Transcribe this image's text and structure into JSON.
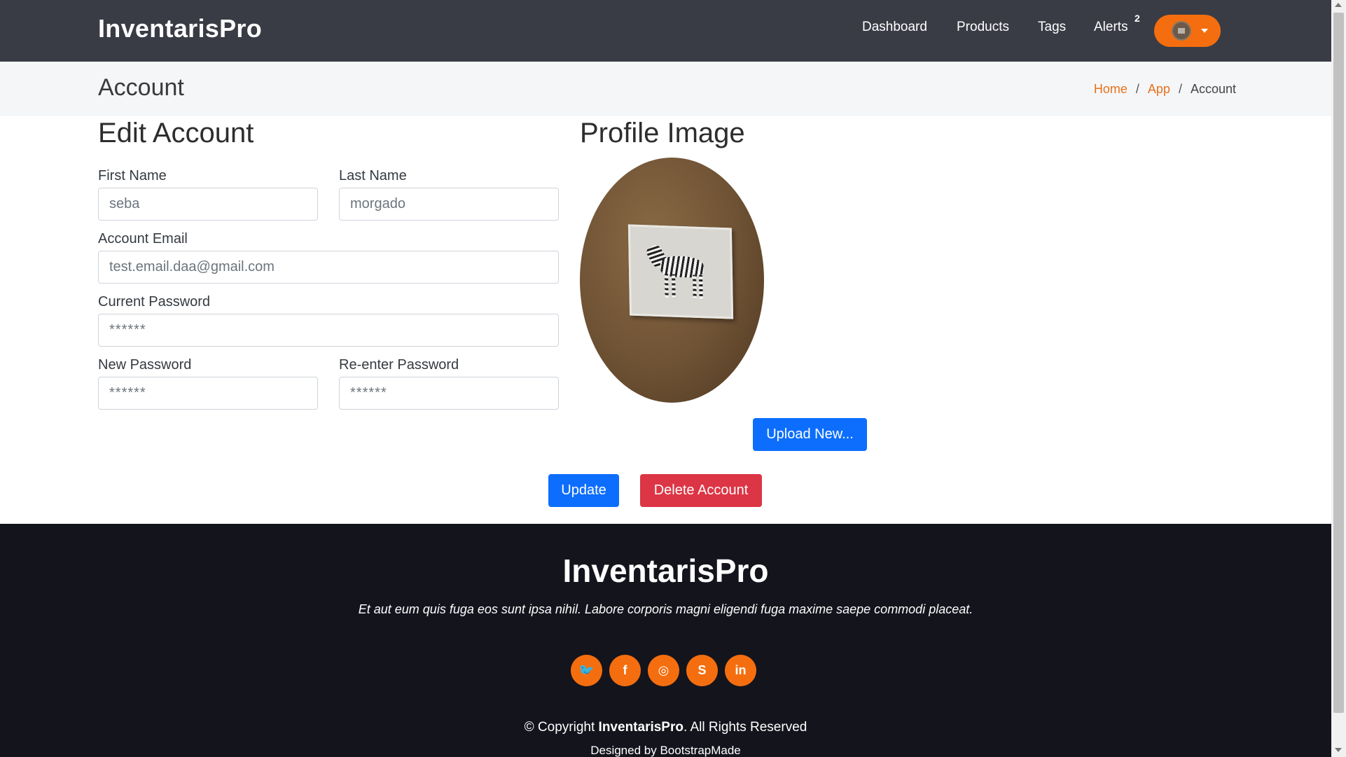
{
  "header": {
    "brand": "InventarisPro",
    "nav": [
      "Dashboard",
      "Products",
      "Tags",
      "Alerts"
    ],
    "alerts_count": "2"
  },
  "page": {
    "title": "Account",
    "breadcrumb": [
      "Home",
      "App",
      "Account"
    ],
    "breadcrumb_separator": "/"
  },
  "form": {
    "heading": "Edit Account",
    "first_name_label": "First Name",
    "first_name_value": "seba",
    "last_name_label": "Last Name",
    "last_name_value": "morgado",
    "email_label": "Account Email",
    "email_value": "test.email.daa@gmail.com",
    "current_password_label": "Current Password",
    "current_password_value": "******",
    "new_password_label": "New Password",
    "new_password_value": "******",
    "reenter_password_label": "Re-enter Password",
    "reenter_password_value": "******",
    "update_label": "Update",
    "delete_label": "Delete Account"
  },
  "profile": {
    "heading": "Profile Image",
    "upload_label": "Upload New..."
  },
  "footer": {
    "brand": "InventarisPro",
    "tagline": "Et aut eum quis fuga eos sunt ipsa nihil. Labore corporis magni eligendi fuga maxime saepe commodi placeat.",
    "socials": [
      {
        "icon": "twitter-icon",
        "glyph": "🐦"
      },
      {
        "icon": "facebook-icon",
        "glyph": "f"
      },
      {
        "icon": "instagram-icon",
        "glyph": "◎"
      },
      {
        "icon": "skype-icon",
        "glyph": "S"
      },
      {
        "icon": "linkedin-icon",
        "glyph": "in"
      }
    ],
    "copyright_prefix": "© Copyright",
    "copyright_brand": "InventarisPro",
    "copyright_suffix": ". All Rights Reserved",
    "designed_by_prefix": "Designed by",
    "designed_by_link": "BootstrapMade"
  },
  "colors": {
    "accent": "#f46e0f",
    "primary": "#0d6efd",
    "danger": "#dc3545",
    "navbar": "#3a3c45",
    "footer": "#14141d"
  }
}
